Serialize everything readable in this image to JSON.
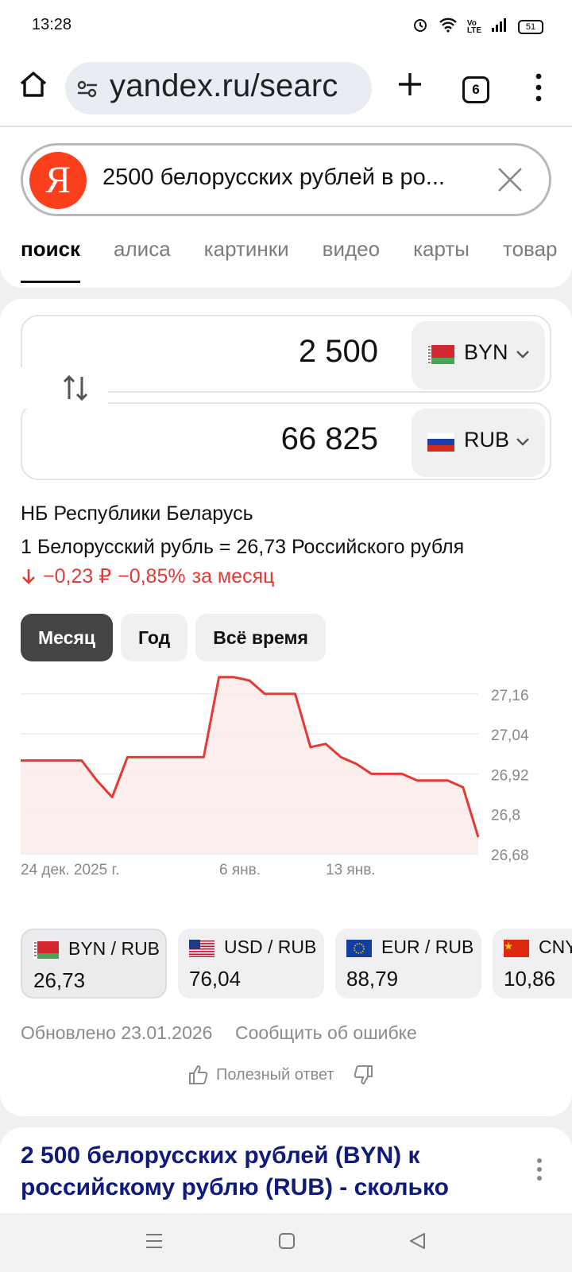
{
  "status": {
    "time": "13:28",
    "battery": "51"
  },
  "browser": {
    "url": "yandex.ru/searc",
    "tab_count": "6"
  },
  "search": {
    "query": "2500 белорусских рублей в ро...",
    "tabs": [
      "поиск",
      "алиса",
      "картинки",
      "видео",
      "карты",
      "товар"
    ]
  },
  "converter": {
    "from": {
      "amount": "2 500",
      "code": "BYN"
    },
    "to": {
      "amount": "66 825",
      "code": "RUB"
    },
    "source": "НБ Республики Беларусь",
    "rate_text": "1 Белорусский рубль = 26,73 Российского рубля",
    "change_abs": "−0,23 ₽",
    "change_pct": "−0,85%",
    "change_period": "за месяц",
    "periods": [
      "Месяц",
      "Год",
      "Всё время"
    ],
    "active_period": "Месяц"
  },
  "chart_data": {
    "type": "line",
    "x_ticks": [
      "24 дек. 2025 г.",
      "6 янв.",
      "13 янв."
    ],
    "y_ticks": [
      "27,16",
      "27,04",
      "26,92",
      "26,8",
      "26,68"
    ],
    "ylim": [
      26.68,
      27.2
    ],
    "series": [
      {
        "values": [
          26.96,
          26.96,
          26.96,
          26.96,
          26.96,
          26.9,
          26.85,
          26.97,
          26.97,
          26.97,
          26.97,
          26.97,
          26.97,
          27.21,
          27.21,
          27.2,
          27.16,
          27.16,
          27.16,
          27.0,
          27.01,
          26.97,
          26.95,
          26.92,
          26.92,
          26.92,
          26.9,
          26.9,
          26.9,
          26.88,
          26.73
        ]
      }
    ],
    "colors": {
      "line": "#e53935",
      "fill": "#fdeaea"
    }
  },
  "pairs": [
    {
      "name": "BYN / RUB",
      "value": "26,73"
    },
    {
      "name": "USD / RUB",
      "value": "76,04"
    },
    {
      "name": "EUR / RUB",
      "value": "88,79"
    },
    {
      "name": "CNY / RUB",
      "value": "10,86"
    }
  ],
  "footer": {
    "updated": "Обновлено 23.01.2026",
    "report": "Сообщить об ошибке",
    "useful": "Полезный ответ"
  },
  "result": {
    "title": "2 500 белорусских рублей (BYN) к российскому рублю (RUB) - сколько"
  }
}
